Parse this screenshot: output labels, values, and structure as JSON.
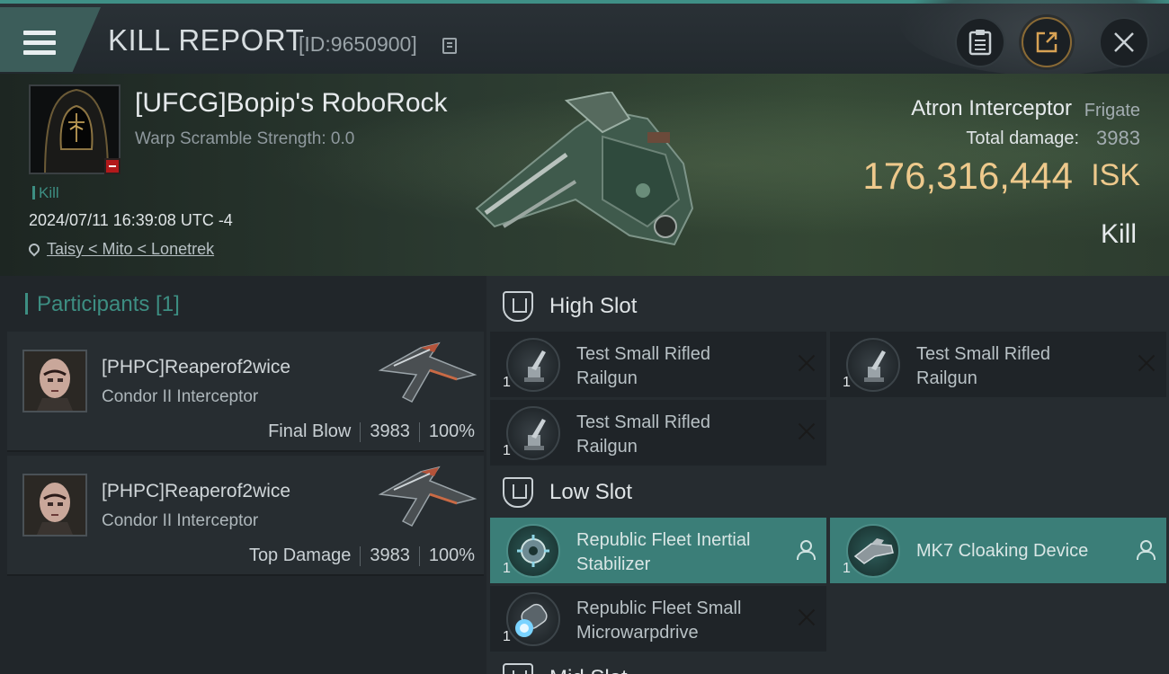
{
  "header": {
    "title": "KILL REPORT",
    "report_id": "[ID:9650900]"
  },
  "victim": {
    "name": "[UFCG]Bopip's RoboRock",
    "warp_scramble": "Warp Scramble Strength: 0.0",
    "tag": "Kill",
    "datetime": "2024/07/11 16:39:08 UTC -4",
    "location": "Taisy < Mito < Lonetrek",
    "ship_name": "Atron Interceptor",
    "ship_class": "Frigate",
    "total_damage_label": "Total damage:",
    "total_damage": "3983",
    "isk_value": "176,316,444",
    "isk_label": "ISK",
    "result": "Kill"
  },
  "participants": {
    "title": "Participants [1]",
    "items": [
      {
        "name": "[PHPC]Reaperof2wice",
        "ship": "Condor II Interceptor",
        "role": "Final Blow",
        "damage": "3983",
        "percent": "100%"
      },
      {
        "name": "[PHPC]Reaperof2wice",
        "ship": "Condor II Interceptor",
        "role": "Top Damage",
        "damage": "3983",
        "percent": "100%"
      }
    ]
  },
  "fitting": {
    "high_slot": {
      "label": "High Slot",
      "modules": [
        {
          "qty": "1",
          "name_line1": "Test Small Rifled",
          "name_line2": "Railgun",
          "status": "destroyed"
        },
        {
          "qty": "1",
          "name_line1": "Test Small Rifled",
          "name_line2": "Railgun",
          "status": "destroyed"
        },
        {
          "qty": "1",
          "name_line1": "Test Small Rifled",
          "name_line2": "Railgun",
          "status": "destroyed"
        }
      ]
    },
    "low_slot": {
      "label": "Low Slot",
      "modules": [
        {
          "qty": "1",
          "name_line1": "Republic Fleet Inertial",
          "name_line2": "Stabilizer",
          "status": "dropped"
        },
        {
          "qty": "1",
          "name_line1": "MK7 Cloaking Device",
          "name_line2": "",
          "status": "dropped"
        },
        {
          "qty": "1",
          "name_line1": "Republic Fleet Small",
          "name_line2": "Microwarpdrive",
          "status": "destroyed"
        }
      ]
    },
    "mid_slot": {
      "label": "Mid Slot"
    }
  },
  "colors": {
    "accent": "#3d8e82",
    "isk": "#eec98c",
    "dropped_bg": "#3b7e78",
    "destroyed_badge": "#b3191b"
  }
}
